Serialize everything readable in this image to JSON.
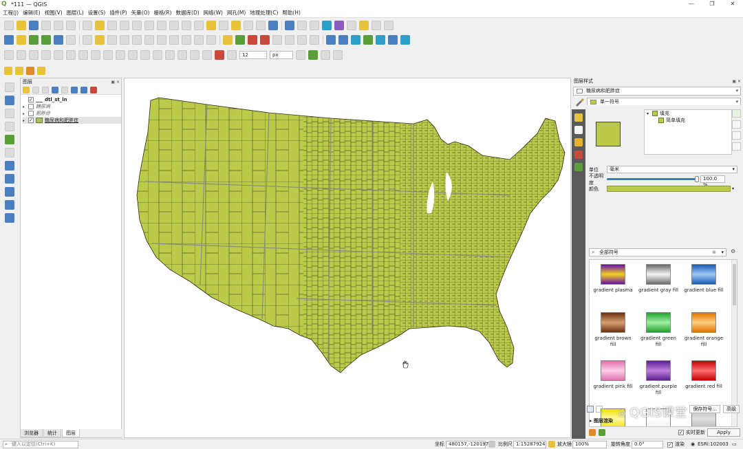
{
  "window": {
    "title": "*111 — QGIS",
    "controls": [
      "—",
      "❐",
      "✕"
    ]
  },
  "menu": [
    "工程(J)",
    "编辑(E)",
    "视图(V)",
    "图层(L)",
    "设置(S)",
    "插件(P)",
    "矢量(O)",
    "栅格(R)",
    "数据库(D)",
    "网络(W)",
    "网孔(M)",
    "地理处理(C)",
    "帮助(H)"
  ],
  "toolbar": {
    "font_size_value": "12",
    "font_unit": "px"
  },
  "layers_panel": {
    "title": "图层",
    "items": [
      {
        "label": "dtl_st_ln",
        "checked": true,
        "bold": true,
        "expandable": false
      },
      {
        "label": "糖尿病",
        "checked": false,
        "italic": true,
        "expandable": true
      },
      {
        "label": "肥胖症",
        "checked": false,
        "italic": true,
        "expandable": true
      },
      {
        "label": "糖尿病和肥胖症",
        "checked": true,
        "selected": true,
        "expandable": true
      }
    ],
    "tabs": [
      "浏览器",
      "统计",
      "图层"
    ],
    "active_tab": "图层"
  },
  "style_panel": {
    "title": "图层样式",
    "layer_select": "糖尿病和肥胖症",
    "renderer_select": "单一符号",
    "symbol_tree": {
      "root": "填充",
      "child": "简单填充"
    },
    "unit_label": "单位",
    "unit_value": "毫米",
    "opacity_label": "不透明度",
    "opacity_value": "100.0 %",
    "opacity_fraction": 1.0,
    "color_label": "颜色",
    "fill_color": "#bcca4a",
    "search_placeholder": "全部符号",
    "gallery": [
      {
        "name": "gradient plasma",
        "c1": "#f0d020",
        "c2": "#6a10a8"
      },
      {
        "name": "gradient  gray fill",
        "c1": "#f4f4f4",
        "c2": "#6a6a6a"
      },
      {
        "name": "gradient blue fill",
        "c1": "#9cc8f4",
        "c2": "#1a5ab0"
      },
      {
        "name": "gradient brown fill",
        "c1": "#d8a070",
        "c2": "#6a3010"
      },
      {
        "name": "gradient green fill",
        "c1": "#a0f0a0",
        "c2": "#20a030"
      },
      {
        "name": "gradient orange fill",
        "c1": "#ffd080",
        "c2": "#e07000"
      },
      {
        "name": "gradient pink fill",
        "c1": "#ffd0e8",
        "c2": "#e070b0"
      },
      {
        "name": "gradient purple fill",
        "c1": "#c080e0",
        "c2": "#5a2090"
      },
      {
        "name": "gradient red fill",
        "c1": "#ff7070",
        "c2": "#c00000"
      },
      {
        "name": "",
        "c1": "#fff8a0",
        "c2": "#f0e000"
      },
      {
        "name": "",
        "c1": "#ffffff",
        "c2": "#f0f0f0"
      },
      {
        "name": "",
        "c1": "#e0e0e0",
        "c2": "#b8b8b8"
      }
    ],
    "save_symbol": "保存符号...",
    "advanced": "高级",
    "layer_render": "图层渲染",
    "live_update": "实时更新",
    "apply": "Apply"
  },
  "statusbar": {
    "locator_placeholder": "键入以定位(Ctrl+K)",
    "coord_label": "坐标",
    "coord_value": "480157,-1201973",
    "scale_label": "比例尺",
    "scale_value": "1:15287924",
    "magnifier_label": "放大镜",
    "magnifier_value": "100%",
    "rotation_label": "旋转角度",
    "rotation_value": "0.0°",
    "render_label": "渲染",
    "crs": "ESRI:102003"
  },
  "watermark": "QGIS课堂",
  "map": {
    "fill": "#bcca4a",
    "stroke": "#2a2a1a"
  }
}
